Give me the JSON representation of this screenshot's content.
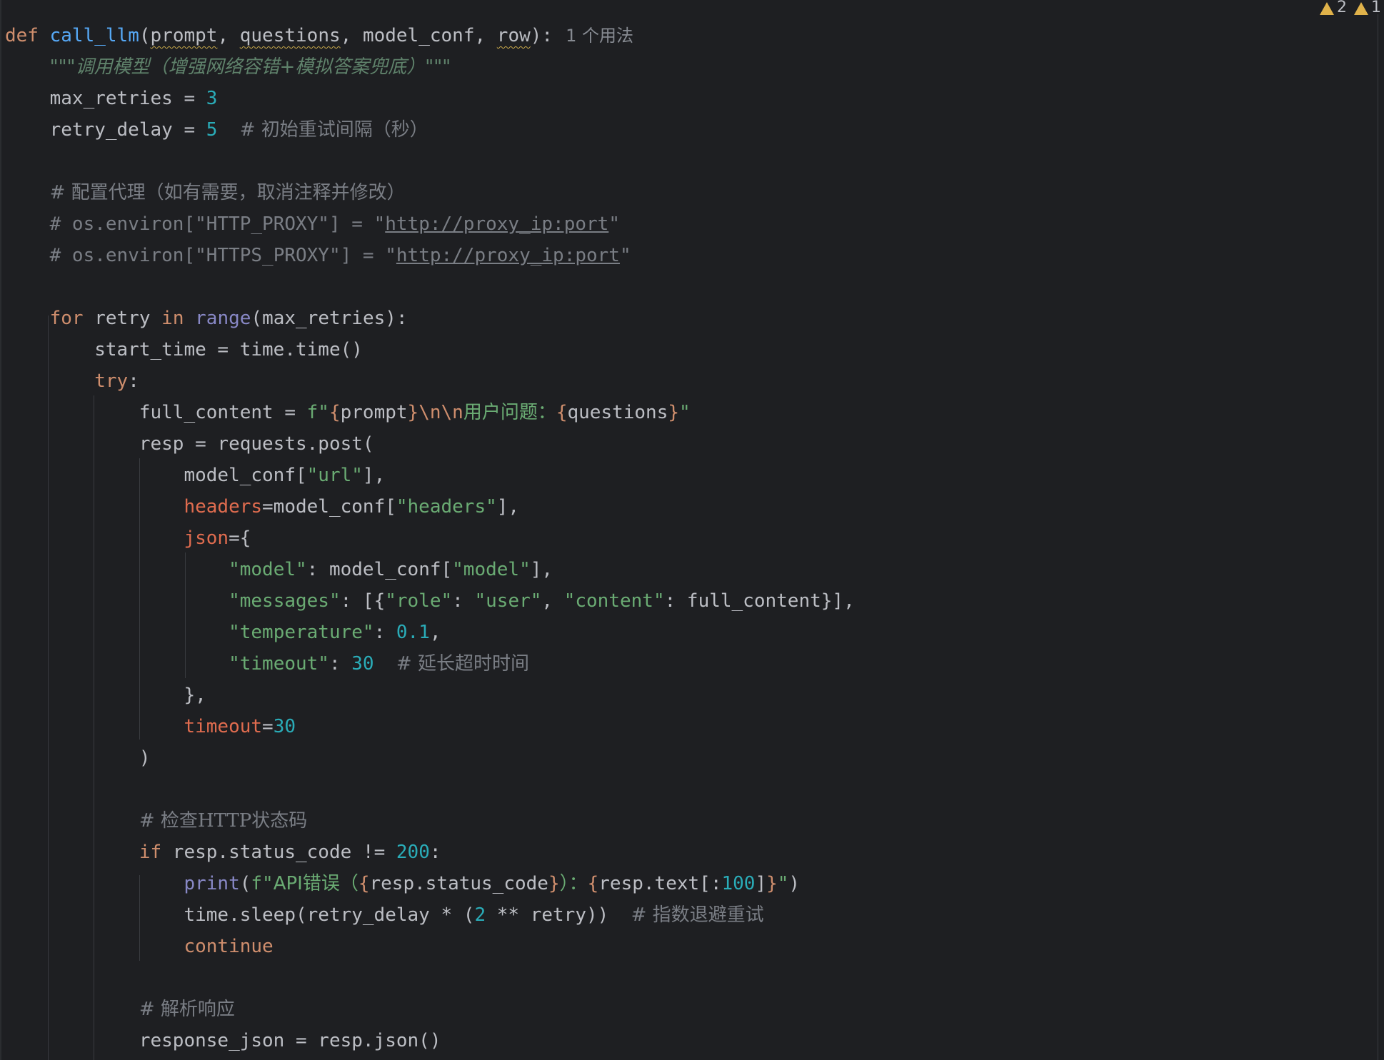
{
  "inspection_widget": {
    "warnings_count": "2",
    "weak_warnings_count": "1"
  },
  "code": {
    "usage_hint": "1 个用法",
    "docstring": "\"\"\"调用模型（增强网络容错+模拟答案兜底）\"\"\"",
    "comment_retry_delay": "# 初始重试间隔（秒）",
    "comment_proxy": "# 配置代理（如有需要，取消注释并修改）",
    "comment_http_proxy_prefix": "# os.environ[\"HTTP_PROXY\"] = \"",
    "comment_https_proxy_prefix": "# os.environ[\"HTTPS_PROXY\"] = \"",
    "proxy_url": "http://proxy_ip:port",
    "fstring_cjk": "用户问题：",
    "comment_timeout": "# 延长超时时间",
    "comment_status": "# 检查HTTP状态码",
    "print_prefix": "API错误（",
    "print_mid": "）：",
    "comment_backoff": "# 指数退避重试",
    "comment_parse": "# 解析响应"
  },
  "colors": {
    "background": "#1e1f22",
    "keyword": "#cf8e6d",
    "function": "#56a8f5",
    "string": "#6aab73",
    "number": "#2aacb8",
    "comment": "#7a7e85",
    "kwarg": "#e06c4f",
    "warning": "#e0b24a"
  }
}
